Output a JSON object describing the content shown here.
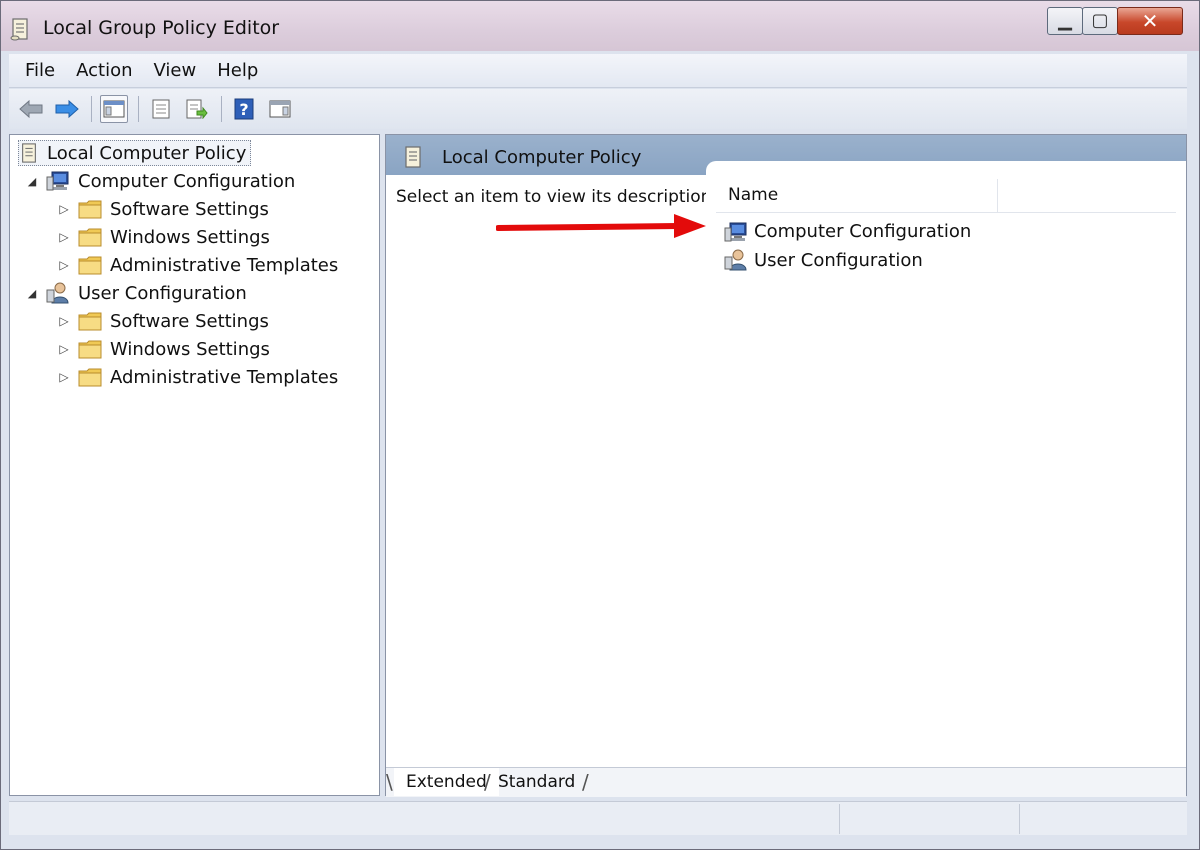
{
  "window": {
    "title": "Local Group Policy Editor",
    "controls": {
      "minimize": "▁",
      "maximize": "▢",
      "close": "✕"
    }
  },
  "menubar": {
    "items": [
      "File",
      "Action",
      "View",
      "Help"
    ]
  },
  "toolbar": {
    "buttons": [
      {
        "icon": "back-arrow-icon"
      },
      {
        "icon": "forward-arrow-icon"
      },
      {
        "icon": "show-hide-console-tree-icon",
        "pressed": true
      },
      {
        "icon": "properties-icon"
      },
      {
        "icon": "export-list-icon"
      },
      {
        "icon": "help-icon"
      },
      {
        "icon": "show-hide-action-pane-icon"
      }
    ]
  },
  "tree": {
    "root": "Local Computer Policy",
    "computer_config": {
      "label": "Computer Configuration",
      "children": [
        "Software Settings",
        "Windows Settings",
        "Administrative Templates"
      ]
    },
    "user_config": {
      "label": "User Configuration",
      "children": [
        "Software Settings",
        "Windows Settings",
        "Administrative Templates"
      ]
    }
  },
  "details": {
    "header": "Local Computer Policy",
    "description": "Select an item to view its description.",
    "column_name": "Name",
    "items": [
      "Computer Configuration",
      "User Configuration"
    ]
  },
  "tabs": {
    "extended": "Extended",
    "standard": "Standard"
  },
  "colors": {
    "annotation_arrow": "#e30b0b",
    "header_blue": "#9ab1cc",
    "folder_yellow": "#f0c955"
  }
}
